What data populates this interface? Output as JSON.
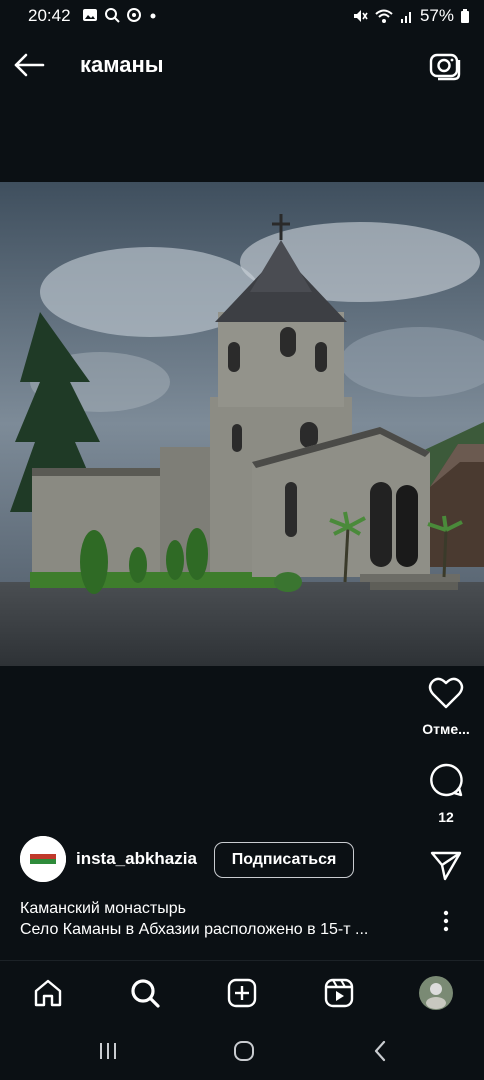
{
  "status_bar": {
    "time": "20:42",
    "battery_percent": "57%",
    "left_icons": [
      "gallery-icon",
      "search-icon",
      "sync-icon",
      "dot-icon"
    ],
    "right_icons": [
      "mute-icon",
      "wifi-icon",
      "signal-icon",
      "battery-icon"
    ]
  },
  "header": {
    "title": "каманы",
    "back_icon": "arrow-left-icon",
    "camera_icon": "camera-icon"
  },
  "post": {
    "image_description_icon": "church-photo",
    "actions": {
      "like_label": "Отме...",
      "comments_count": "12"
    },
    "author": {
      "username": "insta_abkhazia",
      "follow_label": "Подписаться"
    },
    "caption": {
      "title": "Каманский монастырь",
      "body": "Село Каманы в Абхазии расположено в 15-т ..."
    }
  },
  "bottom_nav": {
    "items": [
      "home-icon",
      "search-icon",
      "create-icon",
      "reels-icon",
      "profile-icon"
    ]
  },
  "system_nav": {
    "items": [
      "recents-icon",
      "home-icon",
      "back-icon"
    ]
  },
  "colors": {
    "background": "#0b1014",
    "text": "#ffffff",
    "sky": "#5b6b7a",
    "stone": "#8a8a82",
    "grass": "#3e7d2c"
  }
}
